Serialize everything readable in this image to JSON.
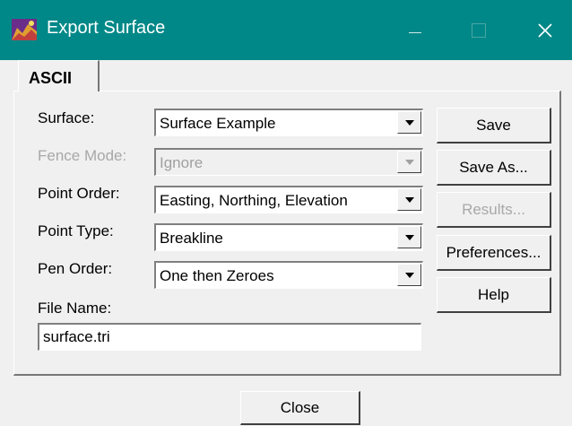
{
  "window": {
    "title": "Export Surface",
    "title_bar_color": "#008888"
  },
  "tab": {
    "label": "ASCII"
  },
  "form": {
    "surface": {
      "label": "Surface:",
      "value": "Surface Example"
    },
    "fence_mode": {
      "label": "Fence Mode:",
      "value": "Ignore",
      "disabled": true
    },
    "point_order": {
      "label": "Point Order:",
      "value": "Easting, Northing, Elevation"
    },
    "point_type": {
      "label": "Point Type:",
      "value": "Breakline"
    },
    "pen_order": {
      "label": "Pen Order:",
      "value": "One then Zeroes"
    },
    "file_name": {
      "label": "File Name:",
      "value": "surface.tri"
    }
  },
  "buttons": {
    "save": "Save",
    "save_as": "Save As...",
    "results": "Results...",
    "preferences": "Preferences...",
    "help": "Help",
    "close": "Close"
  },
  "icons": {
    "app": "export-surface-app-icon",
    "minimize": "minimize-icon",
    "maximize": "maximize-icon",
    "close": "close-icon",
    "dropdown": "chevron-down-icon"
  }
}
